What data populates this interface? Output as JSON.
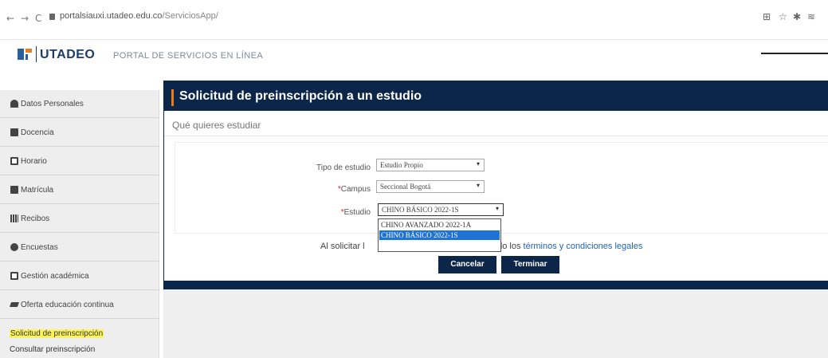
{
  "browser": {
    "url_host": "portalsiauxi.utadeo.edu.co",
    "url_path": "/ServiciosApp/",
    "nav": {
      "back": "←",
      "forward": "→",
      "reload": "C"
    },
    "icons": [
      "reader-icon",
      "star-icon",
      "extension-icon",
      "profile-icon"
    ]
  },
  "header": {
    "logo": "UTADEO",
    "portal": "PORTAL DE SERVICIOS EN LÍNEA"
  },
  "sidebar": {
    "items": [
      {
        "label": "Datos Personales",
        "icon": "person-icon"
      },
      {
        "label": "Docencia",
        "icon": "book-icon"
      },
      {
        "label": "Horario",
        "icon": "calendar-icon"
      },
      {
        "label": "Matrícula",
        "icon": "register-icon"
      },
      {
        "label": "Recibos",
        "icon": "barcode-icon"
      },
      {
        "label": "Encuestas",
        "icon": "chart-icon"
      },
      {
        "label": "Gestión académica",
        "icon": "clipboard-icon"
      },
      {
        "label": "Oferta educación continua",
        "icon": "graduation-cap-icon"
      }
    ],
    "links": [
      {
        "label": "Solicitud de preinscripción",
        "active": true
      },
      {
        "label": "Consultar preinscripción",
        "active": false
      }
    ]
  },
  "main": {
    "title": "Solicitud de preinscripción a un estudio",
    "subtitle": "Qué quieres estudiar",
    "form": {
      "tipo": {
        "label": "Tipo de estudio",
        "value": "Estudio Propio"
      },
      "campus": {
        "label": "Campus",
        "value": "Seccional Bogotá"
      },
      "estudio": {
        "label": "Estudio",
        "value": "CHINO BÁSICO 2022-1S"
      }
    },
    "dropdown_options": [
      {
        "label": "CHINO AVANZADO 2022-1A",
        "selected": false
      },
      {
        "label": "CHINO BÁSICO 2022-1S",
        "selected": true
      }
    ],
    "legal": {
      "prefix": "Al solicitar l",
      "mid": "ndo los ",
      "link": "términos y condiciones legales"
    },
    "buttons": {
      "cancel": "Cancelar",
      "finish": "Terminar"
    }
  },
  "colors": {
    "navy": "#0b2649",
    "accent_orange": "#e67d22",
    "highlight_yellow": "#fff55a",
    "select_blue": "#1e74d6",
    "link_blue": "#2065b3"
  }
}
